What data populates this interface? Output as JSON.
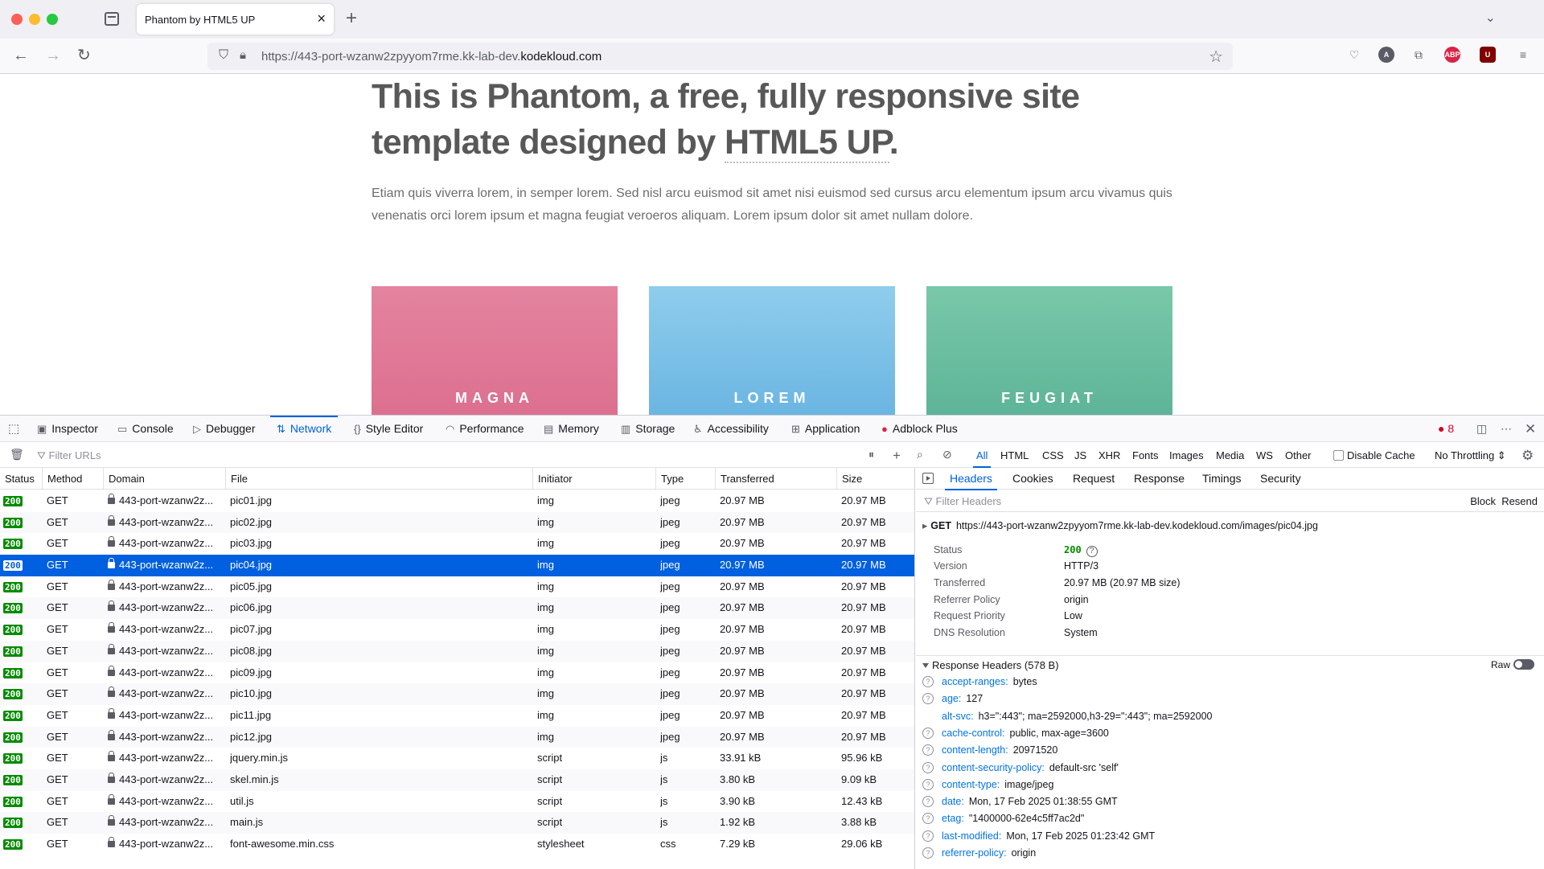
{
  "browser": {
    "tab_title": "Phantom by HTML5 UP",
    "url_prefix": "https://443-port-wzanw2zpyyom7rme.kk-lab-dev.",
    "url_domain": "kodekloud.com"
  },
  "page": {
    "title_part1": "This is Phantom, a free, fully responsive site template designed by ",
    "title_link": "HTML5 UP",
    "title_end": ".",
    "body": "Etiam quis viverra lorem, in semper lorem. Sed nisl arcu euismod sit amet nisi euismod sed cursus arcu elementum ipsum arcu vivamus quis venenatis orci lorem ipsum et magna feugiat veroeros aliquam. Lorem ipsum dolor sit amet nullam dolore.",
    "tiles": [
      "MAGNA",
      "LOREM",
      "FEUGIAT"
    ]
  },
  "devtools": {
    "tabs": [
      "Inspector",
      "Console",
      "Debugger",
      "Network",
      "Style Editor",
      "Performance",
      "Memory",
      "Storage",
      "Accessibility",
      "Application",
      "Adblock Plus"
    ],
    "error_count": "8",
    "filter_placeholder": "Filter URLs",
    "type_filters": [
      "All",
      "HTML",
      "CSS",
      "JS",
      "XHR",
      "Fonts",
      "Images",
      "Media",
      "WS",
      "Other"
    ],
    "disable_cache": "Disable Cache",
    "throttling": "No Throttling",
    "columns": [
      "Status",
      "Method",
      "Domain",
      "File",
      "Initiator",
      "Type",
      "Transferred",
      "Size"
    ],
    "rows": [
      {
        "status": "200",
        "method": "GET",
        "domain": "443-port-wzanw2z...",
        "file": "pic01.jpg",
        "initiator": "img",
        "type": "jpeg",
        "transferred": "20.97 MB",
        "size": "20.97 MB"
      },
      {
        "status": "200",
        "method": "GET",
        "domain": "443-port-wzanw2z...",
        "file": "pic02.jpg",
        "initiator": "img",
        "type": "jpeg",
        "transferred": "20.97 MB",
        "size": "20.97 MB"
      },
      {
        "status": "200",
        "method": "GET",
        "domain": "443-port-wzanw2z...",
        "file": "pic03.jpg",
        "initiator": "img",
        "type": "jpeg",
        "transferred": "20.97 MB",
        "size": "20.97 MB"
      },
      {
        "status": "200",
        "method": "GET",
        "domain": "443-port-wzanw2z...",
        "file": "pic04.jpg",
        "initiator": "img",
        "type": "jpeg",
        "transferred": "20.97 MB",
        "size": "20.97 MB",
        "selected": true
      },
      {
        "status": "200",
        "method": "GET",
        "domain": "443-port-wzanw2z...",
        "file": "pic05.jpg",
        "initiator": "img",
        "type": "jpeg",
        "transferred": "20.97 MB",
        "size": "20.97 MB"
      },
      {
        "status": "200",
        "method": "GET",
        "domain": "443-port-wzanw2z...",
        "file": "pic06.jpg",
        "initiator": "img",
        "type": "jpeg",
        "transferred": "20.97 MB",
        "size": "20.97 MB"
      },
      {
        "status": "200",
        "method": "GET",
        "domain": "443-port-wzanw2z...",
        "file": "pic07.jpg",
        "initiator": "img",
        "type": "jpeg",
        "transferred": "20.97 MB",
        "size": "20.97 MB"
      },
      {
        "status": "200",
        "method": "GET",
        "domain": "443-port-wzanw2z...",
        "file": "pic08.jpg",
        "initiator": "img",
        "type": "jpeg",
        "transferred": "20.97 MB",
        "size": "20.97 MB"
      },
      {
        "status": "200",
        "method": "GET",
        "domain": "443-port-wzanw2z...",
        "file": "pic09.jpg",
        "initiator": "img",
        "type": "jpeg",
        "transferred": "20.97 MB",
        "size": "20.97 MB"
      },
      {
        "status": "200",
        "method": "GET",
        "domain": "443-port-wzanw2z...",
        "file": "pic10.jpg",
        "initiator": "img",
        "type": "jpeg",
        "transferred": "20.97 MB",
        "size": "20.97 MB"
      },
      {
        "status": "200",
        "method": "GET",
        "domain": "443-port-wzanw2z...",
        "file": "pic11.jpg",
        "initiator": "img",
        "type": "jpeg",
        "transferred": "20.97 MB",
        "size": "20.97 MB"
      },
      {
        "status": "200",
        "method": "GET",
        "domain": "443-port-wzanw2z...",
        "file": "pic12.jpg",
        "initiator": "img",
        "type": "jpeg",
        "transferred": "20.97 MB",
        "size": "20.97 MB"
      },
      {
        "status": "200",
        "method": "GET",
        "domain": "443-port-wzanw2z...",
        "file": "jquery.min.js",
        "initiator": "script",
        "type": "js",
        "transferred": "33.91 kB",
        "size": "95.96 kB"
      },
      {
        "status": "200",
        "method": "GET",
        "domain": "443-port-wzanw2z...",
        "file": "skel.min.js",
        "initiator": "script",
        "type": "js",
        "transferred": "3.80 kB",
        "size": "9.09 kB"
      },
      {
        "status": "200",
        "method": "GET",
        "domain": "443-port-wzanw2z...",
        "file": "util.js",
        "initiator": "script",
        "type": "js",
        "transferred": "3.90 kB",
        "size": "12.43 kB"
      },
      {
        "status": "200",
        "method": "GET",
        "domain": "443-port-wzanw2z...",
        "file": "main.js",
        "initiator": "script",
        "type": "js",
        "transferred": "1.92 kB",
        "size": "3.88 kB"
      },
      {
        "status": "200",
        "method": "GET",
        "domain": "443-port-wzanw2z...",
        "file": "font-awesome.min.css",
        "initiator": "stylesheet",
        "type": "css",
        "transferred": "7.29 kB",
        "size": "29.06 kB"
      }
    ],
    "side_tabs": [
      "Headers",
      "Cookies",
      "Request",
      "Response",
      "Timings",
      "Security"
    ],
    "filter_headers": "Filter Headers",
    "block": "Block",
    "resend": "Resend",
    "request_method": "GET",
    "request_url": "https://443-port-wzanw2zpyyom7rme.kk-lab-dev.kodekloud.com/images/pic04.jpg",
    "summary": [
      {
        "k": "Status",
        "v": "200"
      },
      {
        "k": "Version",
        "v": "HTTP/3"
      },
      {
        "k": "Transferred",
        "v": "20.97 MB (20.97 MB size)"
      },
      {
        "k": "Referrer Policy",
        "v": "origin"
      },
      {
        "k": "Request Priority",
        "v": "Low"
      },
      {
        "k": "DNS Resolution",
        "v": "System"
      }
    ],
    "response_headers_title": "Response Headers (578 B)",
    "raw": "Raw",
    "headers": [
      {
        "k": "accept-ranges:",
        "v": "bytes",
        "help": true
      },
      {
        "k": "age:",
        "v": "127",
        "help": true
      },
      {
        "k": "alt-svc:",
        "v": "h3=\":443\"; ma=2592000,h3-29=\":443\"; ma=2592000",
        "help": false
      },
      {
        "k": "cache-control:",
        "v": "public, max-age=3600",
        "help": true
      },
      {
        "k": "content-length:",
        "v": "20971520",
        "help": true
      },
      {
        "k": "content-security-policy:",
        "v": "default-src 'self'",
        "help": true
      },
      {
        "k": "content-type:",
        "v": "image/jpeg",
        "help": true
      },
      {
        "k": "date:",
        "v": "Mon, 17 Feb 2025 01:38:55 GMT",
        "help": true
      },
      {
        "k": "etag:",
        "v": "\"1400000-62e4c5ff7ac2d\"",
        "help": true
      },
      {
        "k": "last-modified:",
        "v": "Mon, 17 Feb 2025 01:23:42 GMT",
        "help": true
      },
      {
        "k": "referrer-policy:",
        "v": "origin",
        "help": true
      }
    ]
  }
}
